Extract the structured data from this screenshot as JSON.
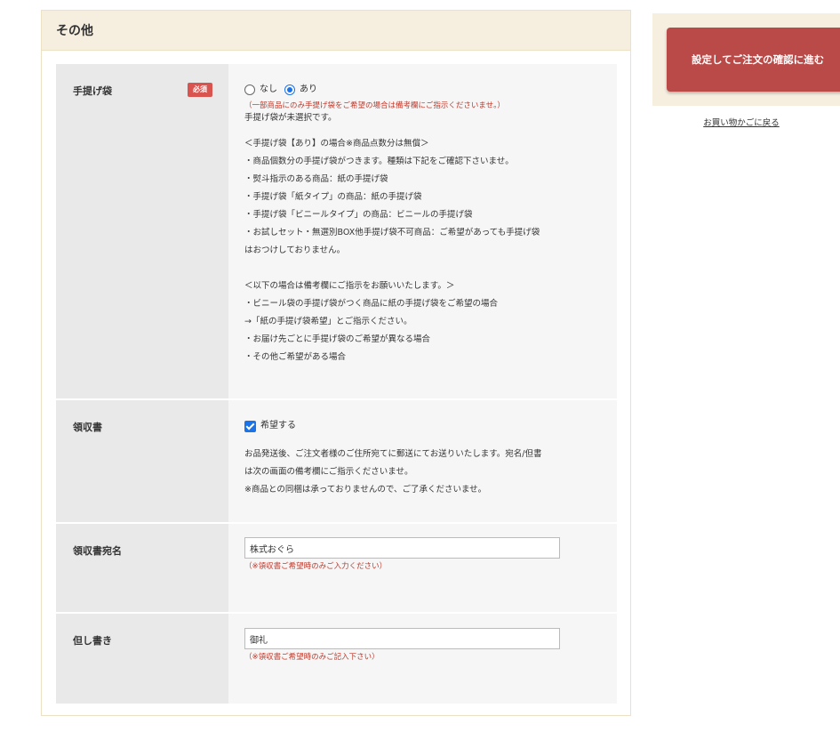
{
  "section": {
    "title": "その他"
  },
  "rows": {
    "bag": {
      "label": "手提げ袋",
      "required": "必須",
      "options": [
        "なし",
        "あり"
      ],
      "selected": "あり",
      "note": "（一部商品にのみ手提げ袋をご希望の場合は備考欄にご指示くださいませ。）",
      "warning": "手提げ袋が未選択です。",
      "info": [
        "＜手提げ袋【あり】の場合※商品点数分は無償＞",
        "・商品個数分の手提げ袋がつきます。種類は下記をご確認下さいませ。",
        "・熨斗指示のある商品：紙の手提げ袋",
        "・手提げ袋「紙タイプ」の商品：紙の手提げ袋",
        "・手提げ袋「ビニールタイプ」の商品：ビニールの手提げ袋",
        "・お試しセット・無選別BOX他手提げ袋不可商品：ご希望があっても手提げ袋",
        "はおつけしておりません。",
        "",
        "＜以下の場合は備考欄にご指示をお願いいたします。＞",
        "・ビニール袋の手提げ袋がつく商品に紙の手提げ袋をご希望の場合",
        "→「紙の手提げ袋希望」とご指示ください。",
        "・お届け先ごとに手提げ袋のご希望が異なる場合",
        "・その他ご希望がある場合"
      ]
    },
    "receipt": {
      "label": "領収書",
      "checkbox_label": "希望する",
      "checked": true,
      "info": [
        "お品発送後、ご注文者様のご住所宛てに郵送にてお送りいたします。宛名/但書",
        "は次の画面の備考欄にご指示くださいませ。",
        "※商品との同梱は承っておりませんので、ご了承くださいませ。"
      ]
    },
    "receipt_name": {
      "label": "領収書宛名",
      "value": "株式おぐら",
      "note": "（※領収書ご希望時のみご入力ください）"
    },
    "proviso": {
      "label": "但し書き",
      "value": "御礼",
      "note": "（※領収書ご希望時のみご記入下さい）"
    }
  },
  "sidebar": {
    "confirm_button": "設定してご注文の確認に進む",
    "back_link": "お買い物かごに戻る"
  },
  "colors": {
    "accent": "#b94a48",
    "required": "#d9534f",
    "radio": "#1a73e8",
    "header_bg": "#f6efe0"
  }
}
